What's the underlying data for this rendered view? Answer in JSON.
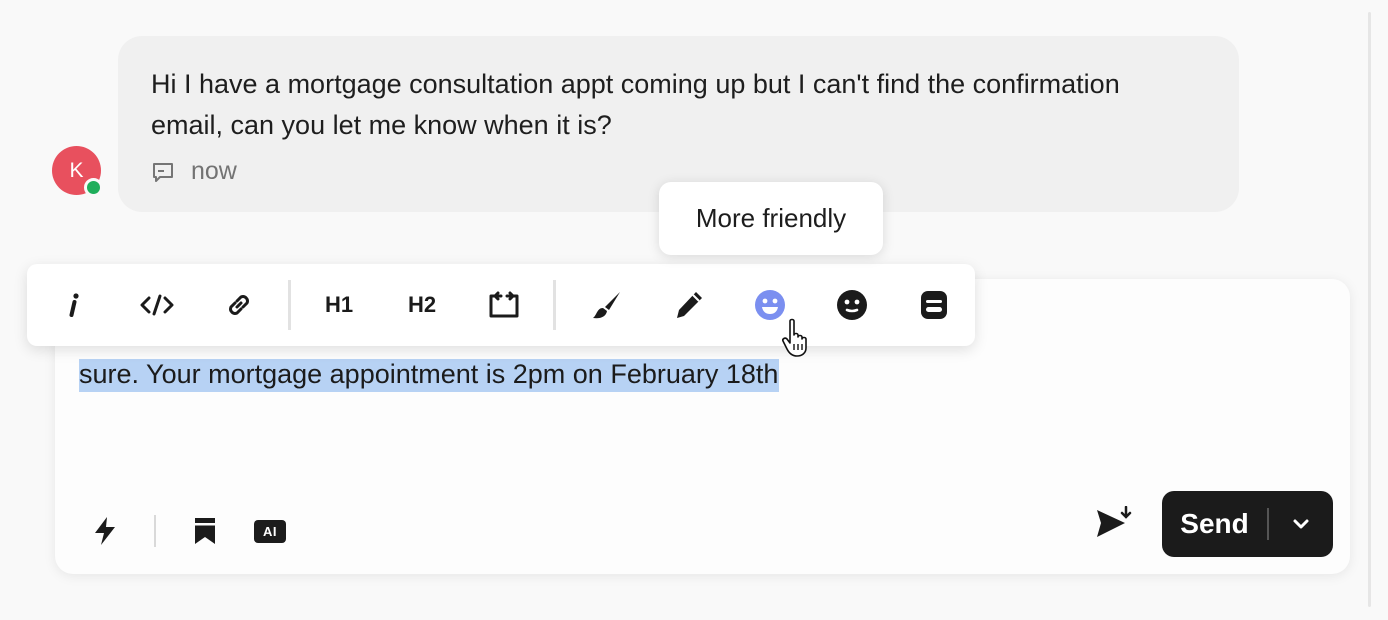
{
  "conversation": {
    "message": {
      "avatar_initial": "K",
      "text": "Hi I have a mortgage consultation appt coming up but I can't find the confirmation email, can you let me know when it is?",
      "meta_icon": "chat-bubble-icon",
      "timestamp": "now"
    }
  },
  "toolbar": {
    "items": [
      {
        "name": "italic-button",
        "icon": "italic-icon"
      },
      {
        "name": "code-button",
        "icon": "code-icon"
      },
      {
        "name": "link-button",
        "icon": "link-icon"
      },
      {
        "name": "heading1-button",
        "label": "H1"
      },
      {
        "name": "heading2-button",
        "label": "H2"
      },
      {
        "name": "code-block-button",
        "icon": "code-block-icon"
      },
      {
        "name": "style-brush-button",
        "icon": "brush-icon"
      },
      {
        "name": "rewrite-pencil-button",
        "icon": "pencil-icon"
      },
      {
        "name": "more-friendly-button",
        "icon": "smiley-icon",
        "active": true
      },
      {
        "name": "more-formal-button",
        "icon": "neutral-face-icon"
      },
      {
        "name": "summarize-button",
        "icon": "document-icon"
      }
    ],
    "tooltip": "More friendly"
  },
  "composer": {
    "draft_text": "sure. Your mortgage appointment is 2pm on February 18th",
    "send_label": "Send"
  },
  "colors": {
    "avatar": "#e8505e",
    "presence": "#1fae5b",
    "accent": "#7b8ff0",
    "selection": "#b7d2f4",
    "send_button": "#1b1b1b"
  }
}
